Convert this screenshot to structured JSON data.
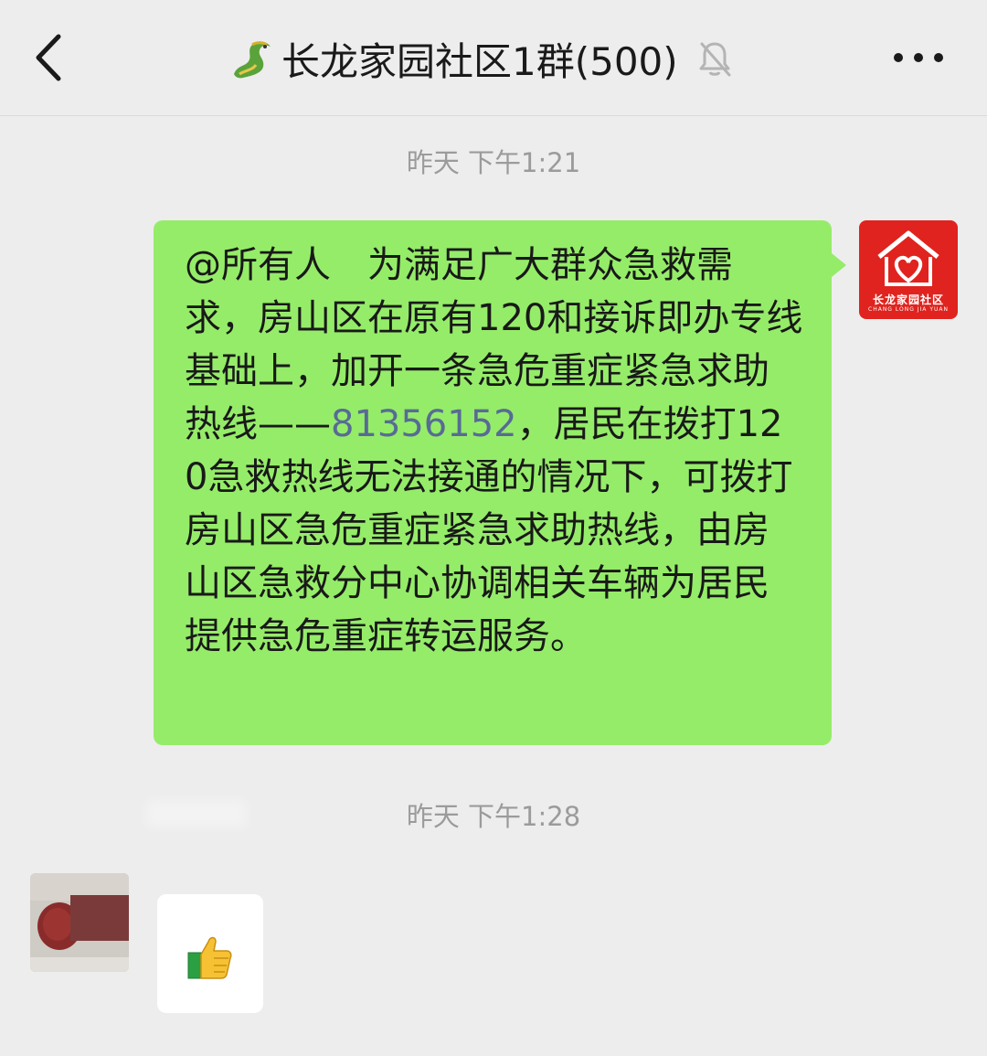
{
  "header": {
    "title": "长龙家园社区1群(500)",
    "back_icon": "chevron-left-icon",
    "group_icon": "dragon-icon",
    "mute_icon": "bell-off-icon",
    "more_icon": "more-dots-icon"
  },
  "messages": [
    {
      "timestamp": "昨天 下午1:21",
      "direction": "sent",
      "text_before": "@所有人　为满足广大群众急救需求，房山区在原有120和接诉即办专线基础上，加开一条急危重症紧急求助热线——",
      "phone": "81356152",
      "text_after": "，居民在拨打120急救热线无法接通的情况下，可拨打房山区急危重症紧急求助热线，由房山区急救分中心协调相关车辆为居民提供急危重症转运服务。",
      "avatar": {
        "name": "长龙家园社区",
        "sub": "CHANG LONG JIA YUAN"
      }
    },
    {
      "timestamp": "昨天 下午1:28",
      "direction": "received",
      "content_icon": "thumbs-up-icon"
    }
  ],
  "colors": {
    "background": "#ededed",
    "sent_bubble": "#95ec69",
    "received_bubble": "#ffffff",
    "link": "#576b95",
    "timestamp": "#9b9b9b",
    "logo_red": "#e0231e"
  }
}
